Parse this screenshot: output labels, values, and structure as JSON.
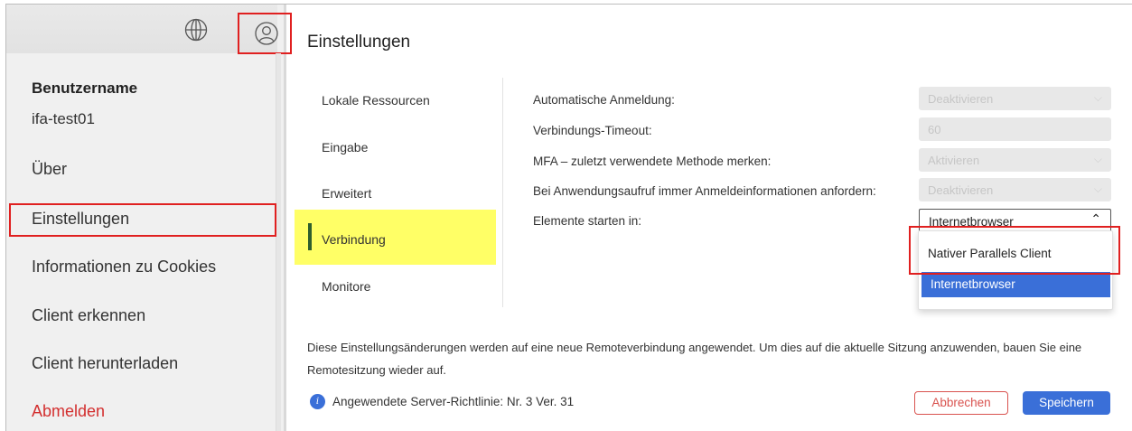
{
  "sidebar": {
    "username_label": "Benutzername",
    "username": "ifa-test01",
    "items": [
      {
        "label": "Über"
      },
      {
        "label": "Einstellungen"
      },
      {
        "label": "Informationen zu Cookies"
      },
      {
        "label": "Client erkennen"
      },
      {
        "label": "Client herunterladen"
      },
      {
        "label": "Abmelden"
      }
    ]
  },
  "main": {
    "title": "Einstellungen",
    "tabs": [
      {
        "label": "Lokale Ressourcen"
      },
      {
        "label": "Eingabe"
      },
      {
        "label": "Erweitert"
      },
      {
        "label": "Verbindung"
      },
      {
        "label": "Monitore"
      }
    ],
    "settings": [
      {
        "label": "Automatische Anmeldung:",
        "value": "Deaktivieren"
      },
      {
        "label": "Verbindungs-Timeout:",
        "value": "60"
      },
      {
        "label": "MFA – zuletzt verwendete Methode merken:",
        "value": "Aktivieren"
      },
      {
        "label": "Bei Anwendungsaufruf immer Anmeldeinformationen anfordern:",
        "value": "Deaktivieren"
      },
      {
        "label": "Elemente starten in:",
        "value": "Internetbrowser"
      }
    ],
    "dropdown_options": [
      "Nativer Parallels Client",
      "Internetbrowser"
    ],
    "info_text": "Diese Einstellungsänderungen werden auf eine neue Remoteverbindung angewendet. Um dies auf die aktuelle Sitzung anzuwenden, bauen Sie eine Remotesitzung wieder auf.",
    "policy_text": "Angewendete Server-Richtlinie: Nr. 3 Ver. 31",
    "info_icon_glyph": "i",
    "cancel_label": "Abbrechen",
    "save_label": "Speichern"
  },
  "colors": {
    "highlight_red": "#e02020",
    "accent_blue": "#3a6fd8",
    "active_tab_yellow": "#ffff66",
    "logout_red": "#d32f2f"
  }
}
